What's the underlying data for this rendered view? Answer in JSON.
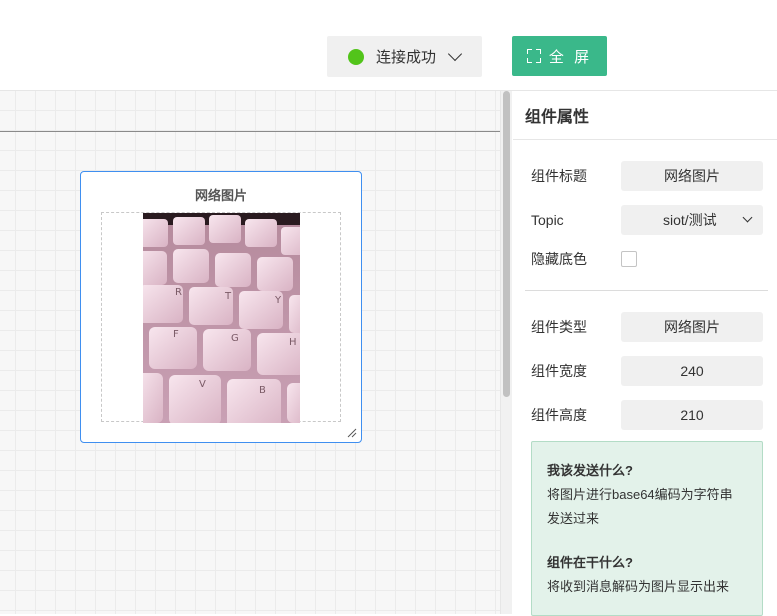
{
  "window": {
    "controls": [
      "minimize-icon",
      "maximize-icon",
      "close-icon"
    ]
  },
  "toolbar": {
    "connection": {
      "label": "连接成功",
      "status_color": "#52c41a",
      "icon": "chevron-down-icon"
    },
    "fullscreen": {
      "label": "全 屏",
      "color": "#3ab88a",
      "icon": "fullscreen-icon"
    }
  },
  "canvas": {
    "widget": {
      "title": "网络图片",
      "image": "keyboard-photo"
    }
  },
  "panel": {
    "title": "组件属性",
    "fields": {
      "title_label": "组件标题",
      "title_value": "网络图片",
      "topic_label": "Topic",
      "topic_value": "siot/测试",
      "hide_bg_label": "隐藏底色",
      "type_label": "组件类型",
      "type_value": "网络图片",
      "width_label": "组件宽度",
      "width_value": "240",
      "height_label": "组件高度",
      "height_value": "210"
    },
    "help": {
      "q1": "我该发送什么?",
      "a1_line1": "将图片进行base64编码为字符串",
      "a1_line2": "发送过来",
      "q2": "组件在干什么?",
      "a2": "将收到消息解码为图片显示出来"
    }
  }
}
